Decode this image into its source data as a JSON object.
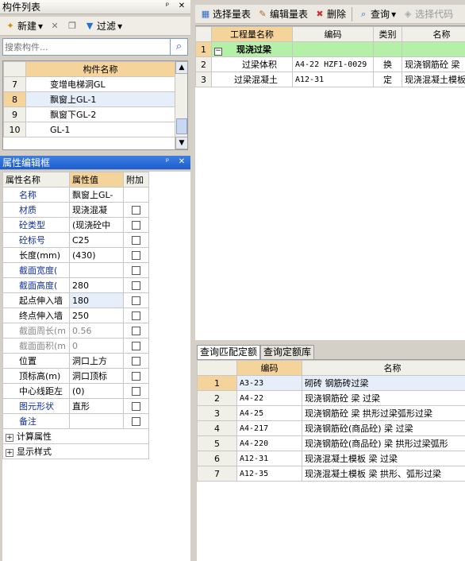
{
  "left_top": {
    "title": "构件列表",
    "toolbar": {
      "new_label": "新建",
      "filter_label": "过滤"
    },
    "search_placeholder": "搜索构件...",
    "header": "构件名称",
    "rows": [
      {
        "num": "7",
        "name": "变增电梯洞GL"
      },
      {
        "num": "8",
        "name": "飘窗上GL-1"
      },
      {
        "num": "9",
        "name": "飘窗下GL-2"
      },
      {
        "num": "10",
        "name": "GL-1"
      }
    ]
  },
  "props": {
    "title": "属性编辑框",
    "headers": {
      "name": "属性名称",
      "value": "属性值",
      "extra": "附加"
    },
    "rows": [
      {
        "name": "名称",
        "value": "飘窗上GL-",
        "style": "blue",
        "check": false
      },
      {
        "name": "材质",
        "value": "现浇混凝",
        "style": "blue",
        "check": true
      },
      {
        "name": "砼类型",
        "value": "(现浇砼中",
        "style": "blue",
        "check": true
      },
      {
        "name": "砼标号",
        "value": "C25",
        "style": "blue",
        "check": true
      },
      {
        "name": "长度(mm)",
        "value": "(430)",
        "style": "normal",
        "check": true
      },
      {
        "name": "截面宽度(",
        "value": "",
        "style": "blue",
        "check": true
      },
      {
        "name": "截面高度(",
        "value": "280",
        "style": "blue",
        "check": true
      },
      {
        "name": "起点伸入墙",
        "value": "180",
        "style": "normal",
        "check": true
      },
      {
        "name": "终点伸入墙",
        "value": "250",
        "style": "normal",
        "check": true
      },
      {
        "name": "截面周长(m",
        "value": "0.56",
        "style": "gray",
        "check": true
      },
      {
        "name": "截面面积(m",
        "value": "0",
        "style": "gray",
        "check": true
      },
      {
        "name": "位置",
        "value": "洞口上方",
        "style": "normal",
        "check": true
      },
      {
        "name": "顶标高(m)",
        "value": "洞口顶标",
        "style": "normal",
        "check": true
      },
      {
        "name": "中心线距左",
        "value": "(0)",
        "style": "normal",
        "check": true
      },
      {
        "name": "图元形状",
        "value": "直形",
        "style": "blue",
        "check": true
      },
      {
        "name": "备注",
        "value": "",
        "style": "blue",
        "check": true
      }
    ],
    "groups": [
      {
        "label": "计算属性"
      },
      {
        "label": "显示样式"
      }
    ]
  },
  "right_top": {
    "toolbar": {
      "select_qty": "选择量表",
      "edit_qty": "编辑量表",
      "delete": "删除",
      "query": "查询",
      "select_code": "选择代码"
    },
    "headers": [
      "工程量名称",
      "编码",
      "类别",
      "名称"
    ],
    "group_row": {
      "num": "1",
      "toggle": "−",
      "name": "现浇过梁"
    },
    "rows": [
      {
        "num": "2",
        "name": "过梁体积",
        "code": "A4-22 HZF1-0029",
        "type": "换",
        "desc": "现浇钢筋砼 梁"
      },
      {
        "num": "3",
        "name": "过梁混凝土",
        "code": "A12-31",
        "type": "定",
        "desc": "现浇混凝土模板"
      }
    ]
  },
  "right_bottom": {
    "tabs": [
      "查询匹配定额",
      "查询定额库"
    ],
    "headers": [
      "编码",
      "名称"
    ],
    "rows": [
      {
        "num": "1",
        "code": "A3-23",
        "name": "砌砖 钢筋砖过梁"
      },
      {
        "num": "2",
        "code": "A4-22",
        "name": "现浇钢筋砼 梁 过梁"
      },
      {
        "num": "3",
        "code": "A4-25",
        "name": "现浇钢筋砼 梁 拱形过梁弧形过梁"
      },
      {
        "num": "4",
        "code": "A4-217",
        "name": "现浇钢筋砼(商品砼) 梁 过梁"
      },
      {
        "num": "5",
        "code": "A4-220",
        "name": "现浇钢筋砼(商品砼) 梁 拱形过梁弧形"
      },
      {
        "num": "6",
        "code": "A12-31",
        "name": "现浇混凝土模板 梁 过梁"
      },
      {
        "num": "7",
        "code": "A12-35",
        "name": "现浇混凝土模板 梁 拱形、弧形过梁"
      }
    ]
  }
}
